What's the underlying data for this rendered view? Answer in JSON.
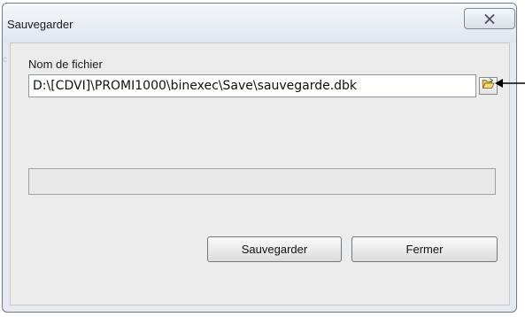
{
  "window": {
    "title": "Sauvegarder",
    "close_icon": "close-x-icon"
  },
  "form": {
    "edge_text": "c",
    "file_label": "Nom de fichier",
    "file_path": "D:\\[CDVI]\\PROMI1000\\binexec\\Save\\sauvegarde.dbk",
    "browse_icon": "open-folder-icon",
    "pointer_icon": "arrow-left-icon"
  },
  "progress": {
    "value": 0
  },
  "buttons": {
    "save_label": "Sauvegarder",
    "close_label": "Fermer"
  },
  "colors": {
    "window_border": "#6e7b8c",
    "client_bg": "#ececec",
    "progress_fill": "#37b24d"
  }
}
